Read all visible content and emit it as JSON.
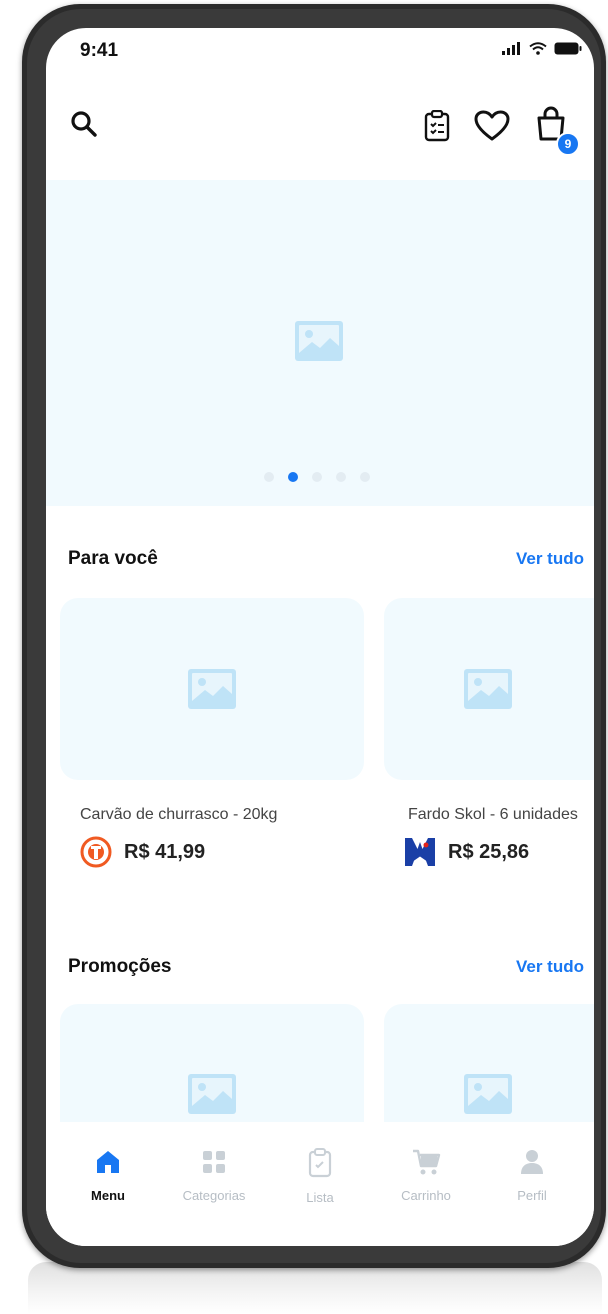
{
  "status_bar": {
    "time": "9:41"
  },
  "header": {
    "cart_count": "9"
  },
  "hero": {
    "active_dot": 1,
    "dot_count": 5
  },
  "sections": [
    {
      "title": "Para você",
      "link": "Ver tudo",
      "products": [
        {
          "name": "Carvão de churrasco - 20kg",
          "price": "R$ 41,99",
          "store_icon": "orange-logo-icon"
        },
        {
          "name": "Fardo Skol - 6 unidades",
          "price": "R$ 25,86",
          "store_icon": "skol-logo-icon"
        }
      ]
    },
    {
      "title": "Promoções",
      "link": "Ver tudo"
    }
  ],
  "bottom_nav": [
    {
      "label": "Menu",
      "icon": "home-icon",
      "active": true
    },
    {
      "label": "Categorias",
      "icon": "grid-icon",
      "active": false
    },
    {
      "label": "Lista",
      "icon": "clipboard-icon",
      "active": false
    },
    {
      "label": "Carrinho",
      "icon": "cart-icon",
      "active": false
    },
    {
      "label": "Perfil",
      "icon": "user-icon",
      "active": false
    }
  ],
  "colors": {
    "accent": "#1877f2",
    "placeholder_bg": "#f1fafe",
    "inactive": "#b6bdc4"
  }
}
